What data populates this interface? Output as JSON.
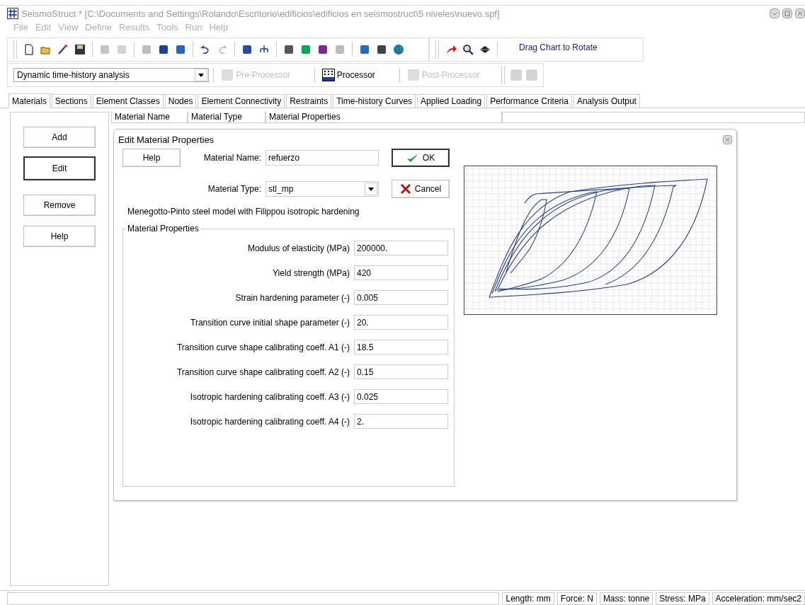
{
  "window": {
    "title": "SeismoStruct * [C:\\Documents and Settings\\Rolando\\Escritorio\\edificios\\edificios en seismostruct\\5 niveles\\nuevo.spf]"
  },
  "menu": [
    "File",
    "Edit",
    "View",
    "Define",
    "Results",
    "Tools",
    "Run",
    "Help"
  ],
  "toolbar": {
    "groups": [
      [
        {
          "disabled": false
        },
        {
          "disabled": false
        },
        {
          "disabled": false
        },
        {
          "disabled": false
        }
      ],
      [
        {
          "disabled": true
        },
        {
          "disabled": true
        }
      ],
      [
        {
          "disabled": true
        },
        {
          "disabled": false
        },
        {
          "disabled": false
        }
      ],
      [
        {
          "disabled": false
        },
        {
          "disabled": true
        }
      ],
      [
        {
          "disabled": false
        },
        {
          "disabled": false
        }
      ],
      [
        {
          "disabled": false
        },
        {
          "disabled": false
        },
        {
          "disabled": false
        },
        {
          "disabled": true
        }
      ],
      [
        {
          "disabled": false
        },
        {
          "disabled": false
        },
        {
          "disabled": false
        }
      ]
    ],
    "chart_tools": [
      {
        "disabled": false
      },
      {
        "disabled": false
      },
      {
        "disabled": false
      }
    ],
    "hint": "Drag Chart to Rotate"
  },
  "analysis_bar": {
    "analysis_type": "Dynamic time-history analysis",
    "modules": [
      {
        "label": "Pre-Processor",
        "disabled": true
      },
      {
        "label": "Processor",
        "disabled": false
      },
      {
        "label": "Post-Processor",
        "disabled": true
      }
    ],
    "extra_buttons": [
      {
        "disabled": true
      },
      {
        "disabled": true
      }
    ]
  },
  "tabs": [
    {
      "label": "Materials",
      "selected": true
    },
    {
      "label": "Sections",
      "selected": false
    },
    {
      "label": "Element Classes",
      "selected": false
    },
    {
      "label": "Nodes",
      "selected": false
    },
    {
      "label": "Element Connectivity",
      "selected": false
    },
    {
      "label": "Restraints",
      "selected": false
    },
    {
      "label": "Time-history Curves",
      "selected": false
    },
    {
      "label": "Applied Loading",
      "selected": false
    },
    {
      "label": "Performance Criteria",
      "selected": false
    },
    {
      "label": "Analysis Output",
      "selected": false
    }
  ],
  "side_buttons": [
    {
      "label": "Add",
      "selected": false
    },
    {
      "label": "Edit",
      "selected": true
    },
    {
      "label": "Remove",
      "selected": false
    },
    {
      "label": "Help",
      "selected": false
    }
  ],
  "table": {
    "columns": [
      "Material Name",
      "Material Type",
      "Material Properties"
    ]
  },
  "dialog": {
    "title": "Edit Material Properties",
    "help_button": "Help",
    "name_label": "Material Name:",
    "name_value": "refuerzo",
    "type_label": "Material Type:",
    "type_value": "stl_mp",
    "ok_button": "OK",
    "cancel_button": "Cancel",
    "description": "Menegotto-Pinto steel model with Filippou isotropic hardening",
    "group_title": "Material Properties",
    "properties": [
      {
        "label": "Modulus of elasticity (MPa)",
        "value": "200000."
      },
      {
        "label": "Yield strength (MPa)",
        "value": "420"
      },
      {
        "label": "Strain hardening parameter (-)",
        "value": "0.005"
      },
      {
        "label": "Transition curve initial shape parameter (-)",
        "value": "20."
      },
      {
        "label": "Transition curve shape calibrating coeff. A1 (-)",
        "value": "18.5"
      },
      {
        "label": "Transition curve shape calibrating coeff. A2 (-)",
        "value": "0.15"
      },
      {
        "label": "Isotropic hardening calibrating coeff. A3 (-)",
        "value": "0.025"
      },
      {
        "label": "Isotropic hardening calibrating coeff. A4 (-)",
        "value": "2."
      }
    ]
  },
  "status_bar": [
    "Length: mm",
    "Force: N",
    "Mass: tonne",
    "Stress: MPa",
    "Acceleration: mm/sec2"
  ]
}
